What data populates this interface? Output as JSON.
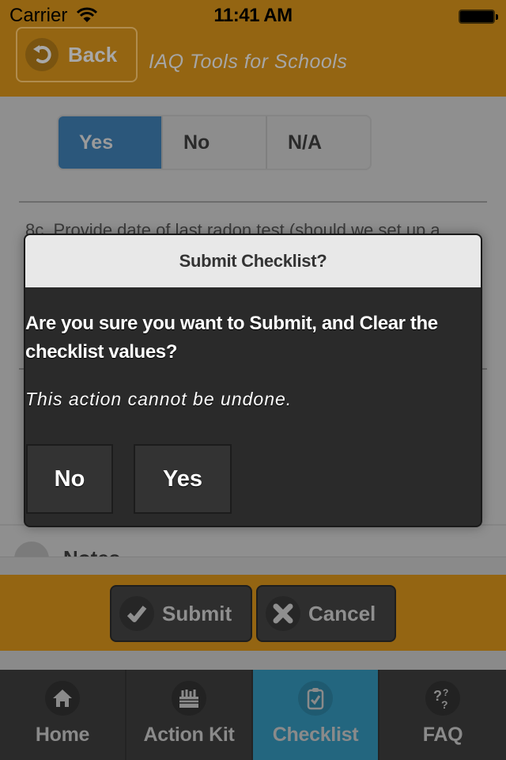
{
  "status_bar": {
    "carrier": "Carrier",
    "time": "11:41 AM"
  },
  "header": {
    "back_label": "Back",
    "title": "IAQ Tools for Schools"
  },
  "content": {
    "segmented": {
      "options": [
        "Yes",
        "No",
        "N/A"
      ],
      "selected": "Yes"
    },
    "question_text": "8c. Provide date of last radon test (should we set up a",
    "notes_label": "Notes"
  },
  "action_bar": {
    "submit_label": "Submit",
    "cancel_label": "Cancel"
  },
  "tab_bar": {
    "tabs": [
      {
        "label": "Home",
        "icon": "home-icon"
      },
      {
        "label": "Action Kit",
        "icon": "toolbox-icon"
      },
      {
        "label": "Checklist",
        "icon": "clipboard-check-icon"
      },
      {
        "label": "FAQ",
        "icon": "question-marks-icon"
      }
    ],
    "active": "Checklist"
  },
  "dialog": {
    "title": "Submit Checklist?",
    "message": "Are you sure you want to Submit, and Clear the checklist values?",
    "note": "This action cannot be undone.",
    "no_label": "No",
    "yes_label": "Yes"
  },
  "colors": {
    "brand_gold": "#946512",
    "active_tab": "#23667f",
    "selected_segment": "#2b577b"
  }
}
